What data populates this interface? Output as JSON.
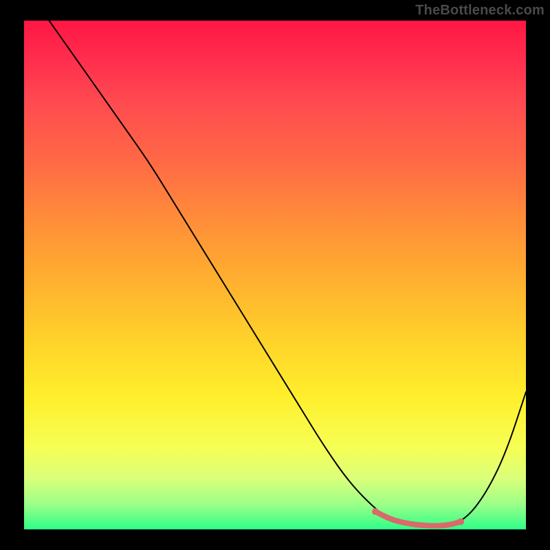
{
  "watermark": "TheBottleneck.com",
  "chart_data": {
    "type": "line",
    "title": "",
    "xlabel": "",
    "ylabel": "",
    "xlim": [
      0,
      100
    ],
    "ylim": [
      0,
      100
    ],
    "x": [
      5,
      10,
      15,
      20,
      25,
      30,
      35,
      40,
      45,
      50,
      55,
      60,
      65,
      70,
      73,
      76,
      80,
      84,
      88,
      92,
      96,
      100
    ],
    "values": [
      100,
      93,
      86,
      79,
      72,
      64,
      56,
      48,
      40,
      32,
      24,
      16,
      9,
      4,
      2,
      1,
      0.5,
      0.5,
      2,
      7,
      15,
      27
    ],
    "highlight_segment": {
      "x": [
        70,
        73,
        76,
        80,
        84,
        87
      ],
      "values": [
        3.5,
        2,
        1.2,
        0.7,
        0.7,
        1.5
      ],
      "color": "#d96a6a",
      "width": 8
    },
    "highlight_endpoints": [
      {
        "x": 70,
        "y": 3.5,
        "r": 5,
        "color": "#d96a6a"
      },
      {
        "x": 87,
        "y": 1.5,
        "r": 5,
        "color": "#d96a6a"
      }
    ],
    "background_gradient": {
      "top": "#ff1744",
      "mid": "#ffd02a",
      "bottom": "#2fff88"
    }
  }
}
